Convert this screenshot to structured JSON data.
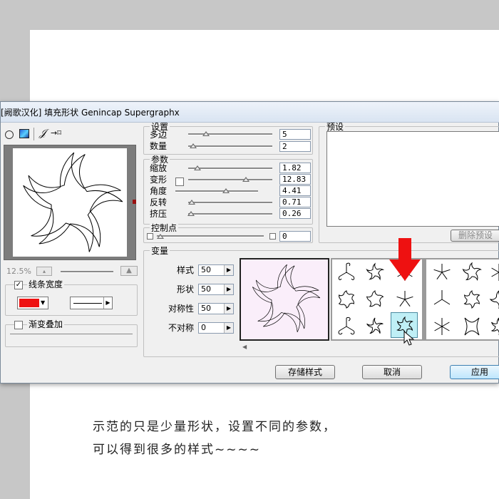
{
  "dialog": {
    "title": "[阙歌汉化] 填充形状 Genincap Supergraphx"
  },
  "left_panel": {
    "zoom_text": "12.5%",
    "stroke_width_label": "线条宽度",
    "stroke_checked": true,
    "stroke_color": "#ee1111",
    "gradient_label": "渐变叠加",
    "gradient_checked": false
  },
  "settings": {
    "legend": "设置",
    "polygon_label": "多边",
    "polygon_value": "5",
    "count_label": "数量",
    "count_value": "2"
  },
  "params": {
    "legend": "参数",
    "scale_label": "缩放",
    "scale_value": "1.82",
    "deform_label": "变形",
    "deform_value": "12.83",
    "angle_label": "角度",
    "angle_value": "4.41",
    "reverse_label": "反转",
    "reverse_value": "0.71",
    "squeeze_label": "挤压",
    "squeeze_value": "0.26"
  },
  "control_point": {
    "legend": "控制点",
    "value": "0"
  },
  "preset": {
    "legend": "预设",
    "delete_button": "删除预设"
  },
  "variation": {
    "legend": "变量",
    "style_label": "样式",
    "style_value": "50",
    "shape_label": "形状",
    "shape_value": "50",
    "symmetry_label": "对称性",
    "symmetry_value": "50",
    "asym_label": "不对称",
    "asym_value": "0"
  },
  "buttons": {
    "save_style": "存储样式",
    "cancel": "取消",
    "apply": "应用"
  },
  "caption": {
    "line1": "示范的只是少量形状，设置不同的参数，",
    "line2": "可以得到很多的样式~~~~"
  },
  "icons": {
    "selection_arrow": "red-down-arrow-icon",
    "cursor": "mouse-pointer-icon"
  }
}
